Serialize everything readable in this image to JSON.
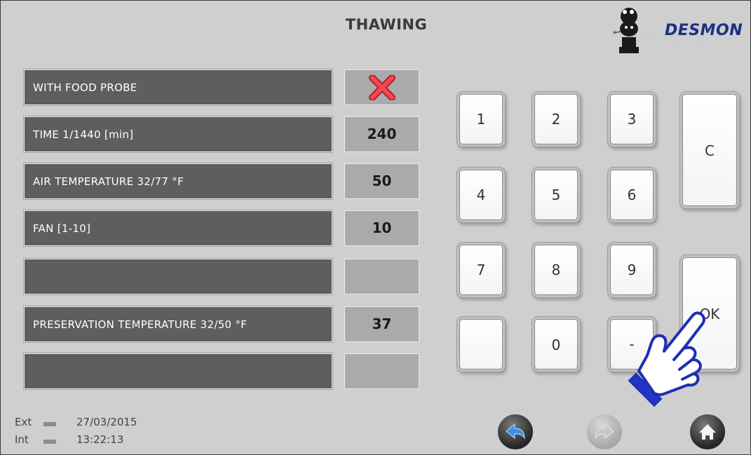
{
  "header": {
    "title": "THAWING",
    "brand": "DESMON"
  },
  "rows": [
    {
      "label": "WITH FOOD PROBE",
      "value": "",
      "icon": "x-icon"
    },
    {
      "label": "TIME 1/1440 [min]",
      "value": "240"
    },
    {
      "label": "AIR TEMPERATURE  32/77 °F",
      "value": "50"
    },
    {
      "label": "FAN [1-10]",
      "value": "10"
    },
    {
      "label": "",
      "value": ""
    },
    {
      "label": "PRESERVATION TEMPERATURE 32/50 °F",
      "value": "37"
    },
    {
      "label": "",
      "value": ""
    }
  ],
  "keypad": {
    "k1": "1",
    "k2": "2",
    "k3": "3",
    "k4": "4",
    "k5": "5",
    "k6": "6",
    "k7": "7",
    "k8": "8",
    "k9": "9",
    "blank": "",
    "k0": "0",
    "minus": "-",
    "clear": "C",
    "ok": "OK"
  },
  "status": {
    "ext_label": "Ext",
    "int_label": "Int",
    "date": "27/03/2015",
    "time": "13:22:13"
  },
  "colors": {
    "panel": "#cfcfcf",
    "label_bg": "#5e5e5e",
    "value_bg": "#aaaaaa",
    "brand": "#1c2f86",
    "x_red": "#e8333a",
    "hand_outline": "#1f2fb5"
  },
  "icons": {
    "back": "back-arrow-icon",
    "forward": "forward-arrow-icon",
    "home": "home-icon",
    "pointer": "pointing-hand-icon",
    "logo": "chef-logo-icon"
  }
}
